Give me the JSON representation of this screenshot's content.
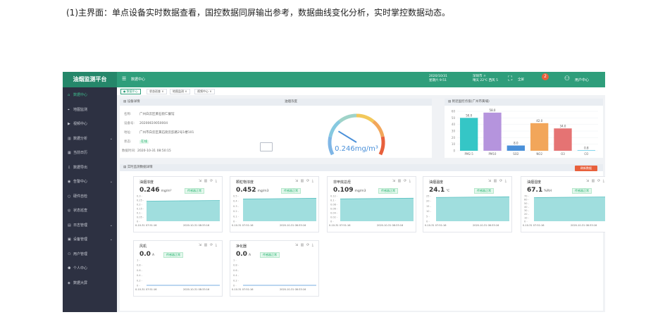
{
  "caption": "(1)主界面：单点设备实时数据查看，国控数据同屏输出参考，数据曲线变化分析，实时掌控数据动态。",
  "header": {
    "brand": "油烟监测平台",
    "breadcrumb": "数据中心",
    "datetime": [
      "2020/10/31",
      "星期六 9:51"
    ],
    "weather": [
      "深圳市 ☼",
      "晴天 22℃ 西风 5"
    ],
    "fullscreen": "全屏",
    "badge": "2",
    "user": "用户中心"
  },
  "sidebar": [
    {
      "label": "数据中心",
      "icon": "home-icon",
      "active": true
    },
    {
      "label": "地图监测",
      "icon": "map-icon"
    },
    {
      "label": "视频中心",
      "icon": "video-icon"
    },
    {
      "label": "数据分析",
      "icon": "chart-icon",
      "arrow": true
    },
    {
      "label": "当前日历",
      "icon": "calendar-icon"
    },
    {
      "label": "数据导出",
      "icon": "export-icon"
    },
    {
      "label": "告警中心",
      "icon": "alarm-icon",
      "arrow": true
    },
    {
      "label": "硬件自检",
      "icon": "check-icon"
    },
    {
      "label": "状态巡查",
      "icon": "status-icon"
    },
    {
      "label": "日志管理",
      "icon": "log-icon",
      "arrow": true
    },
    {
      "label": "设备管理",
      "icon": "device-icon",
      "arrow": true
    },
    {
      "label": "用户管理",
      "icon": "users-icon"
    },
    {
      "label": "个人中心",
      "icon": "person-icon"
    },
    {
      "label": "数据大屏",
      "icon": "screen-icon"
    }
  ],
  "tabs": [
    "● 数据中心",
    "状态巡查 ×",
    "地图监测 ×",
    "视频中心 ×"
  ],
  "device": {
    "title": "设备详情",
    "btn_video": "视频监控",
    "btn_select": "选择设备",
    "rows": [
      {
        "k": "名称:",
        "v": "广州白云区黄石街仁餐馆"
      },
      {
        "k": "设备号:",
        "v": "20200619050004"
      },
      {
        "k": "地址:",
        "v": "广州市白云区黄石街云彭路2号1楼101"
      },
      {
        "k": "状态:",
        "v": "在线"
      },
      {
        "k": "数据时间:",
        "v": "2020-10-31 08:50:15"
      }
    ]
  },
  "gauge": {
    "title": "油烟浓度",
    "value": "0.246mg/m³",
    "fraction": 0.25
  },
  "national": {
    "title": "附近国控点值(广州市黄埔)",
    "chart_data": {
      "type": "bar",
      "categories": [
        "PM2.5",
        "PM10",
        "SO2",
        "NO2",
        "O3",
        "CO"
      ],
      "values": [
        50.0,
        58.0,
        8.0,
        42.0,
        34.0,
        0.8
      ],
      "colors": [
        "#35c6c6",
        "#b594dd",
        "#4a90d9",
        "#f2a65a",
        "#e57373",
        "#5ec8e8"
      ],
      "ylim": [
        0,
        60
      ],
      "yticks": [
        "0",
        "10",
        "20",
        "30",
        "40",
        "50",
        "60"
      ]
    }
  },
  "realtime": {
    "title": "实时监测数据详情",
    "refresh": "刷新数据",
    "toolbar_icons": "⇲ ▥ ⟳ ⤓",
    "cards": [
      {
        "name": "油烟浓度",
        "value": "0.246",
        "unit": "mg/m³",
        "badge": "传感器正常",
        "yticks": [
          "0.3",
          "0.25",
          "0.2",
          "0.15",
          "0.1",
          "0.05",
          "0"
        ],
        "ylim": [
          0,
          0.3
        ],
        "level": 0.246,
        "x_start": "0-10-31 07:51:16",
        "x_end": "2020-10-31 08:33:16"
      },
      {
        "name": "颗粒物浓度",
        "value": "0.452",
        "unit": "mg/m3",
        "badge": "传感器正常",
        "yticks": [
          "0.5",
          "0.4",
          "0.3",
          "0.2",
          "0.1",
          "0"
        ],
        "ylim": [
          0,
          0.5
        ],
        "level": 0.452,
        "x_start": "0-10-31 07:51:16",
        "x_end": "2020-10-31 08:33:16"
      },
      {
        "name": "非甲烷总烃",
        "value": "0.109",
        "unit": "mg/m3",
        "badge": "传感器正常",
        "yticks": [
          "0.12",
          "0.1",
          "0.08",
          "0.06",
          "0.04",
          "0.02",
          "0"
        ],
        "ylim": [
          0,
          0.12
        ],
        "level": 0.109,
        "x_start": "0-10-31 07:51:16",
        "x_end": "2020-10-31 08:33:16"
      },
      {
        "name": "油烟温度",
        "value": "24.1",
        "unit": "℃",
        "badge": "传感器正常",
        "yticks": [
          "25",
          "20",
          "15",
          "10",
          "5",
          "0"
        ],
        "ylim": [
          0,
          25
        ],
        "level": 24.1,
        "x_start": "0-10-31 07:51:16",
        "x_end": "2020-10-31 08:33:16"
      },
      {
        "name": "油烟湿度",
        "value": "67.1",
        "unit": "%RH",
        "badge": "传感器正常",
        "yticks": [
          "70",
          "60",
          "50",
          "40",
          "30",
          "20",
          "10",
          "0"
        ],
        "ylim": [
          0,
          70
        ],
        "level": 67.1,
        "x_start": "0-10-31 07:51:16",
        "x_end": "2020-10-31 08:33:16"
      },
      {
        "name": "风机",
        "value": "0.0",
        "unit": "A",
        "badge": "传感器正常",
        "yticks": [
          "1",
          "0.8",
          "0.6",
          "0.4",
          "0.2",
          "0"
        ],
        "ylim": [
          0,
          1
        ],
        "level": 0,
        "x_start": "0-10-31 07:51:16",
        "x_end": "2020-10-31 08:33:16"
      },
      {
        "name": "净化器",
        "value": "0.0",
        "unit": "A",
        "badge": "传感器正常",
        "yticks": [
          "1",
          "0.8",
          "0.6",
          "0.4",
          "0.2",
          "0"
        ],
        "ylim": [
          0,
          1
        ],
        "level": 0,
        "x_start": "0-10-31 07:51:16",
        "x_end": "2020-10-31 08:33:16"
      }
    ]
  }
}
